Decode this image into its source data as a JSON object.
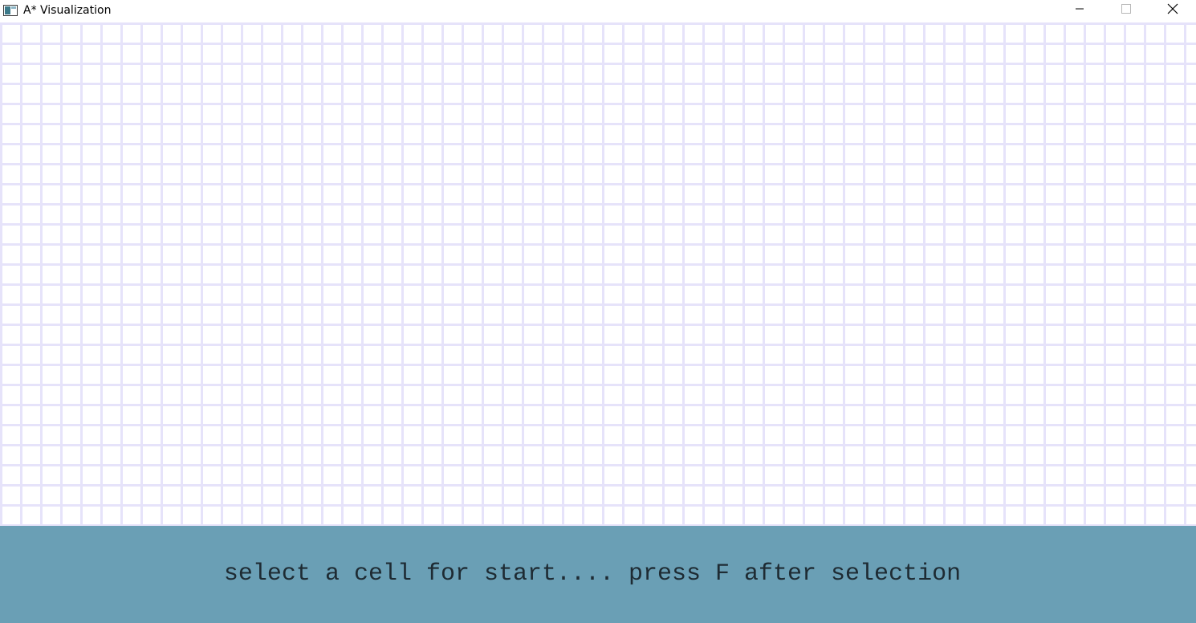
{
  "window": {
    "title": "A* Visualization",
    "icon": "app-window-icon",
    "controls": {
      "minimize_icon": "minimize-icon",
      "maximize_icon": "maximize-icon",
      "close_icon": "close-icon"
    }
  },
  "grid": {
    "cell_color": "#ffffff",
    "line_color": "#e6e3fa"
  },
  "status": {
    "message": "select a cell for start.... press F after selection",
    "background_color": "#6a9fb5",
    "text_color": "#1e2b33"
  }
}
